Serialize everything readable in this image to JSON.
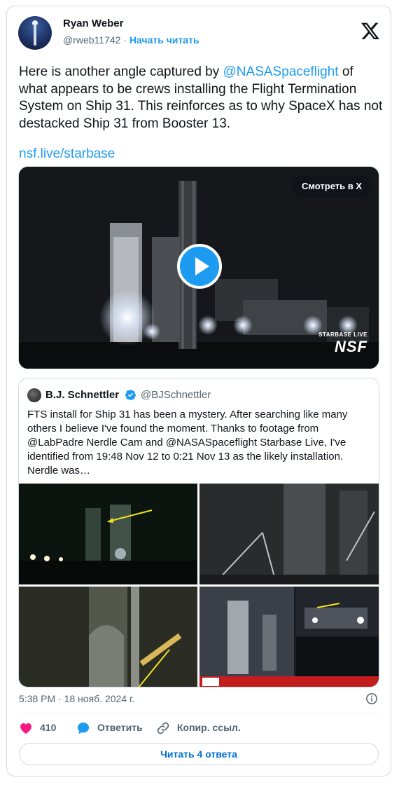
{
  "author": {
    "name": "Ryan Weber",
    "handle": "@rweb11742",
    "separator": "·",
    "follow_label": "Начать читать"
  },
  "tweet": {
    "text_before": "Here is another angle captured by ",
    "mention": "@NASASpaceflight",
    "text_after": " of what appears to be crews installing the Flight Termination System on Ship 31. This reinforces as to why SpaceX has not destacked Ship 31 from Booster 13.",
    "link": "nsf.live/starbase"
  },
  "video": {
    "watch_label": "Смотреть в X",
    "watermark_top": "STARBASE LIVE",
    "watermark_brand": "NSF"
  },
  "quote": {
    "name": "B.J. Schnettler",
    "handle": "@BJSchnettler",
    "text": "FTS install for Ship 31 has been a mystery. After searching like many others I believe I've found the moment. Thanks to footage from @LabPadre Nerdle Cam and @NASASpaceflight Starbase Live, I've identified from 19:48 Nov 12 to 0:21 Nov 13 as the likely installation. Nerdle was…"
  },
  "meta": {
    "timestamp": "5:38 PM · 18 нояб. 2024 г."
  },
  "actions": {
    "like_count": "410",
    "reply_label": "Ответить",
    "copy_label": "Копир. ссыл."
  },
  "footer": {
    "read_replies_label": "Читать 4 ответа"
  },
  "colors": {
    "accent": "#1d9bf0",
    "like": "#f91880",
    "text": "#0f1419",
    "secondary": "#536471",
    "border": "#cfd9de"
  }
}
